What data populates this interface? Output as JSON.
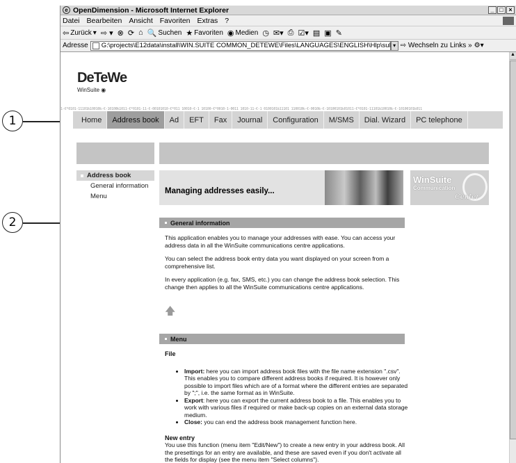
{
  "callouts": [
    "1",
    "2"
  ],
  "window": {
    "title": "OpenDimension - Microsoft Internet Explorer",
    "controls": [
      "_",
      "□",
      "×"
    ]
  },
  "menubar": [
    "Datei",
    "Bearbeiten",
    "Ansicht",
    "Favoriten",
    "Extras",
    "?"
  ],
  "toolbar": {
    "back": "Zurück",
    "search": "Suchen",
    "favorites": "Favoriten",
    "media": "Medien"
  },
  "addressbar": {
    "label": "Adresse",
    "url": "G:\\projects\\E12data\\install\\WIN.SUITE COMMON_DETEWE\\Files\\LANGUAGES\\ENGLISH\\Hlp\\subs\\addressbook.htm",
    "go": "Wechseln zu",
    "links": "Links"
  },
  "logo": {
    "brand": "DeTeWe",
    "sub": "WinSuite"
  },
  "binary_strip": "1-€*0101-11101‰10010‰-€-10100‰1011-€*0101-11-€-00101010-€*011 10010-€-1 10100-€*0010-1-0011 1010-11-€-1 0100101‰11101 110010‰-€-0010‰-€-10100101‰01011-€*0101-11101‰10010‰-€-10100101‰011",
  "nav": {
    "tabs": [
      "Home",
      "Address book",
      "Ad",
      "EFT",
      "Fax",
      "Journal",
      "Configuration",
      "M/SMS",
      "Dial. Wizard",
      "PC telephone"
    ],
    "active": "Address book"
  },
  "sidebar": {
    "items": [
      "Address book",
      "General information",
      "Menu"
    ],
    "active": "Address book"
  },
  "banner": {
    "headline": "Managing addresses easily...",
    "winsuite_title": "WinSuite",
    "winsuite_comm": "Communication",
    "winsuite_center": "Center"
  },
  "general": {
    "header": "General information",
    "p1": "This application enables you to manage your addresses with ease. You can access your address data in all the WinSuite communications centre applications.",
    "p2": "You can select the address book entry data you want displayed on your screen from a comprehensive list.",
    "p3": "In every application (e.g. fax, SMS, etc.) you can change the address book selection. This change then applies to all the WinSuite communications centre applications."
  },
  "menu": {
    "header": "Menu",
    "file_title": "File",
    "import_label": "Import:",
    "import_text": " here you can import address book files with the file name extension \".csv\". This enables you to compare different address books if required. It is however only possible to import files which are of a format where the different entries are separated by \";\", i.e. the same format as in WinSuite.",
    "export_label": "Export",
    "export_text": ": here you can export the current address book to a file. This enables you to work with various files if required or make back-up copies on an external data storage medium.",
    "close_label": "Close:",
    "close_text": " you can end the address book management function here.",
    "new_entry_title": "New entry",
    "new_entry_text": "You use this function (menu item \"Edit/New\") to create a new entry in your address book. All the presettings for an entry are available, and these are saved even if you don't activate all the fields for display (see the menu item \"Select columns\")."
  }
}
